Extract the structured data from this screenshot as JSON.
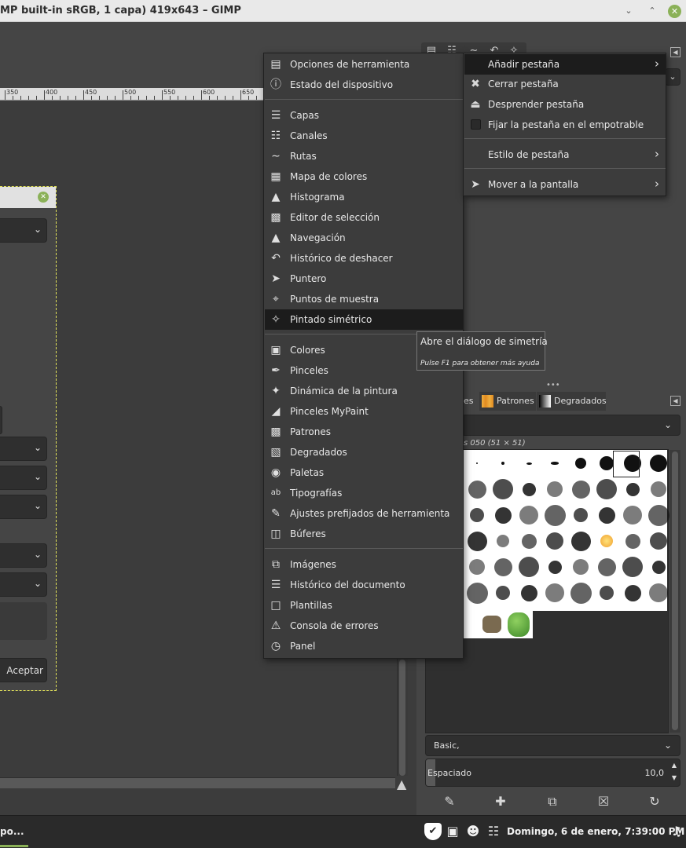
{
  "window": {
    "title": "MP built-in sRGB, 1 capa) 419x643 – GIMP",
    "minimize_icon": "chevron-down",
    "maximize_icon": "chevron-up",
    "close_icon": "close"
  },
  "ruler": {
    "labels": [
      "350",
      "400",
      "450",
      "500",
      "550",
      "600",
      "650"
    ]
  },
  "dialog": {
    "accept_label": "Aceptar"
  },
  "main_menu": {
    "items": [
      {
        "label": "Opciones de herramienta",
        "icon": "tool-options"
      },
      {
        "label": "Estado del dispositivo",
        "icon": "device-status"
      },
      {
        "label": "Capas",
        "icon": "layers"
      },
      {
        "label": "Canales",
        "icon": "channels"
      },
      {
        "label": "Rutas",
        "icon": "paths"
      },
      {
        "label": "Mapa de colores",
        "icon": "colormap"
      },
      {
        "label": "Histograma",
        "icon": "histogram"
      },
      {
        "label": "Editor de selección",
        "icon": "selection-editor"
      },
      {
        "label": "Navegación",
        "icon": "navigation"
      },
      {
        "label": "Histórico de deshacer",
        "icon": "undo-history"
      },
      {
        "label": "Puntero",
        "icon": "pointer"
      },
      {
        "label": "Puntos de muestra",
        "icon": "sample-points"
      },
      {
        "label": "Pintado simétrico",
        "icon": "symmetry-butterfly"
      },
      {
        "label": "Colores",
        "icon": "colors"
      },
      {
        "label": "Pinceles",
        "icon": "brushes"
      },
      {
        "label": "Dinámica de la pintura",
        "icon": "paint-dynamics"
      },
      {
        "label": "Pinceles MyPaint",
        "icon": "mypaint-brushes"
      },
      {
        "label": "Patrones",
        "icon": "patterns"
      },
      {
        "label": "Degradados",
        "icon": "gradients"
      },
      {
        "label": "Paletas",
        "icon": "palettes"
      },
      {
        "label": "Tipografías",
        "icon": "fonts"
      },
      {
        "label": "Ajustes prefijados de herramienta",
        "icon": "tool-presets"
      },
      {
        "label": "Búferes",
        "icon": "buffers"
      },
      {
        "label": "Imágenes",
        "icon": "images"
      },
      {
        "label": "Histórico del documento",
        "icon": "document-history"
      },
      {
        "label": "Plantillas",
        "icon": "templates"
      },
      {
        "label": "Consola de errores",
        "icon": "error-console"
      },
      {
        "label": "Panel",
        "icon": "dashboard"
      }
    ],
    "highlighted": "Pintado simétrico"
  },
  "sub_menu": {
    "items": [
      {
        "label": "Añadir pestaña",
        "has_submenu": true
      },
      {
        "label": "Cerrar pestaña",
        "icon": "close"
      },
      {
        "label": "Desprender pestaña",
        "icon": "eject"
      },
      {
        "label": "Fijar la pestaña en el empotrable",
        "checkbox": false
      },
      {
        "label": "Estilo de pestaña",
        "has_submenu": true
      },
      {
        "label": "Mover a la pantalla",
        "has_submenu": true,
        "icon": "move-to-screen"
      }
    ],
    "highlighted": "Añadir pestaña"
  },
  "tooltip": {
    "text": "Abre el diálogo de simetría",
    "help": "Pulse F1 para obtener más ayuda"
  },
  "brushes_dock": {
    "tabs": [
      {
        "label": "es"
      },
      {
        "label": "Patrones"
      },
      {
        "label": "Degradados"
      }
    ],
    "brush_name": "s 050 (51 × 51)",
    "preset": "Basic,",
    "spacing_label": "Espaciado",
    "spacing_value": "10,0",
    "actions": [
      "edit-brush",
      "new-brush",
      "duplicate-brush",
      "delete-brush",
      "refresh-brushes"
    ]
  },
  "taskbar": {
    "item_label": "po...",
    "clock": "Domingo,  6 de enero,  7:39:00 PM"
  },
  "colors": {
    "menu_bg": "#3c3c3c",
    "highlight_bg": "#1c1c1c",
    "accent_green": "#8bb158",
    "dock_bg": "#454545",
    "canvas_bg": "#3c3c3c"
  }
}
